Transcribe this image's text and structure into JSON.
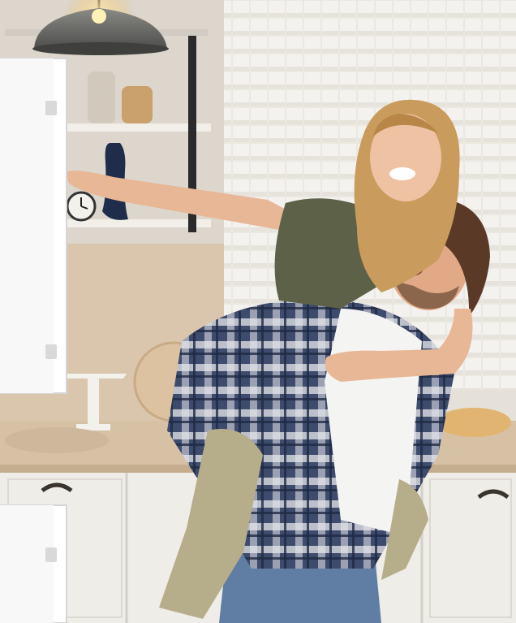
{
  "image": {
    "kind": "photograph",
    "subject": "couple-piggyback-in-kitchen"
  },
  "colors": {
    "wall": "#e9e4dc",
    "tile": "#f1efea",
    "counter": "#d8c3a6",
    "cabinet": "#eeece6",
    "shirt_plaid": "#3b4a6a",
    "shirt_white": "#f4f4f2",
    "woman_top": "#5d6148",
    "pants": "#b7ad8a",
    "jeans": "#5f7da3",
    "hair_blonde": "#c79a5c",
    "hair_dark": "#5a3a27",
    "skin": "#e7b493"
  }
}
